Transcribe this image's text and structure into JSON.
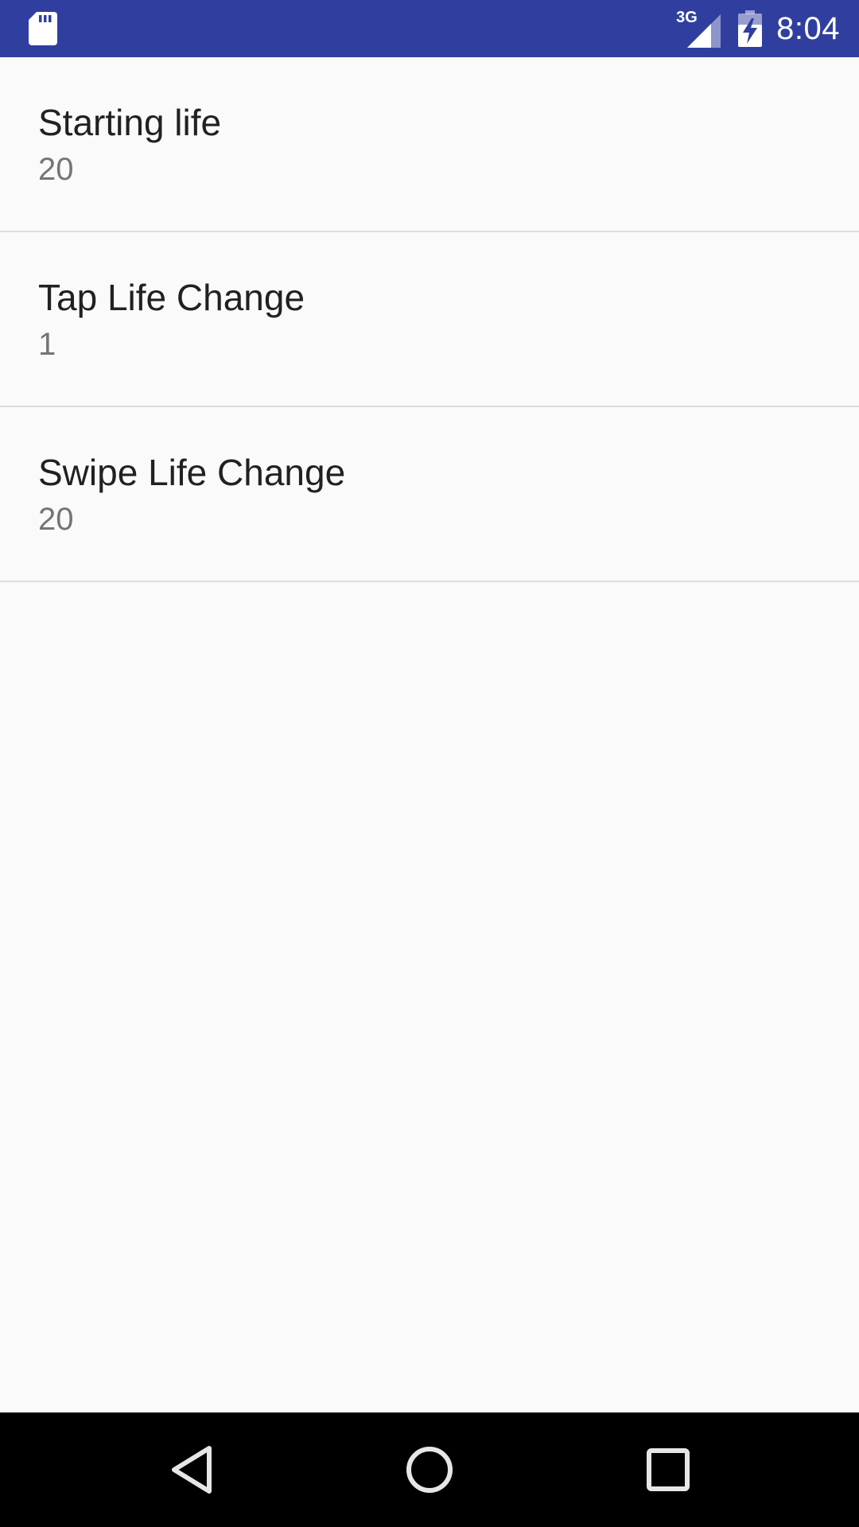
{
  "status_bar": {
    "network_type": "3G",
    "time": "8:04",
    "icons": [
      "sd-card-icon",
      "signal-icon",
      "battery-charging-icon"
    ],
    "background_color": "#303F9F"
  },
  "preferences": [
    {
      "title": "Starting life",
      "summary": "20"
    },
    {
      "title": "Tap Life Change",
      "summary": "1"
    },
    {
      "title": "Swipe Life Change",
      "summary": "20"
    }
  ],
  "nav_bar": {
    "icons": [
      "back-icon",
      "home-icon",
      "recents-icon"
    ]
  }
}
